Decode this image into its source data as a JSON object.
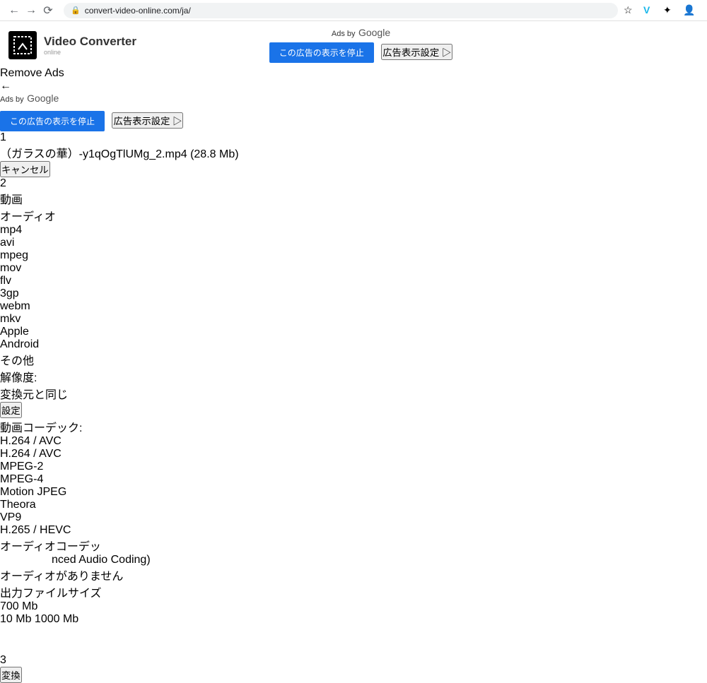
{
  "browser": {
    "url": "convert-video-online.com/ja/"
  },
  "header": {
    "logo_title": "Video Converter",
    "logo_sub": "online"
  },
  "ads": {
    "label": "Ads by",
    "google": "Google",
    "stop": "この広告の表示を停止",
    "settings": "広告表示設定 ▷",
    "remove": "Remove Ads"
  },
  "step1": {
    "filename": "（ガラスの華）-y1qOgTlUMg_2.mp4 (28.8 Mb)",
    "cancel": "キャンセル"
  },
  "step2": {
    "tab_video": "動画",
    "tab_audio": "オーディオ",
    "formats": [
      "mp4",
      "avi",
      "mpeg",
      "mov",
      "flv",
      "3gp",
      "webm",
      "mkv",
      "Apple",
      "Android",
      "その他"
    ],
    "active_format": "mkv",
    "res_label": "解像度:",
    "res_value": "変換元と同じ",
    "settings_btn": "設定",
    "vcodec_label": "動画コーデック:",
    "vcodec_value": "H.264 / AVC",
    "vcodec_options": [
      "H.264 / AVC",
      "MPEG-2",
      "MPEG-4",
      "Motion JPEG",
      "Theora",
      "VP9",
      "H.265 / HEVC"
    ],
    "acodec_label": "オーディオコーデッ",
    "acodec_value": "nced Audio Coding)",
    "no_audio": "オーディオがありません",
    "size_label": "出力ファイルサイズ",
    "size_min": "10 Mb",
    "size_max": "1000 Mb",
    "size_val": "700 Mb"
  },
  "step3": {
    "convert": "変換"
  }
}
